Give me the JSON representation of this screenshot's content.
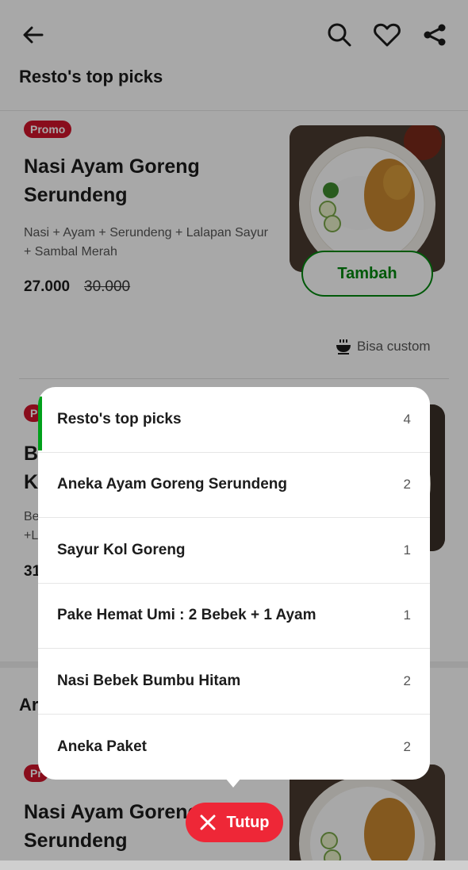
{
  "header": {
    "title": "Resto's top picks",
    "icons": [
      "arrow-left-icon",
      "search-icon",
      "heart-icon",
      "share-icon"
    ]
  },
  "cards": [
    {
      "promo": "Promo",
      "name": "Nasi Ayam Goreng Serundeng",
      "description": "Nasi + Ayam + Serundeng + Lalapan Sayur + Sambal Merah",
      "price": "27.000",
      "old_price": "30.000",
      "add_label": "Tambah",
      "custom_label": "Bisa custom"
    },
    {
      "promo": "P",
      "name": "B K",
      "description": "Be +L",
      "price": "31"
    },
    {
      "promo": "Pr",
      "name": "Nasi Ayam Goreng Serundeng"
    }
  ],
  "section_title": "Ar",
  "menu": {
    "items": [
      {
        "label": "Resto's top picks",
        "count": "4"
      },
      {
        "label": "Aneka Ayam Goreng Serundeng",
        "count": "2"
      },
      {
        "label": "Sayur Kol Goreng",
        "count": "1"
      },
      {
        "label": "Pake Hemat Umi : 2 Bebek + 1 Ayam",
        "count": "1"
      },
      {
        "label": "Nasi Bebek Bumbu Hitam",
        "count": "2"
      },
      {
        "label": "Aneka Paket",
        "count": "2"
      }
    ],
    "active_index": 0
  },
  "close_button": {
    "label": "Tutup"
  },
  "colors": {
    "accent_green": "#00880e",
    "promo_red": "#d0142b",
    "close_red": "#ee2737"
  }
}
